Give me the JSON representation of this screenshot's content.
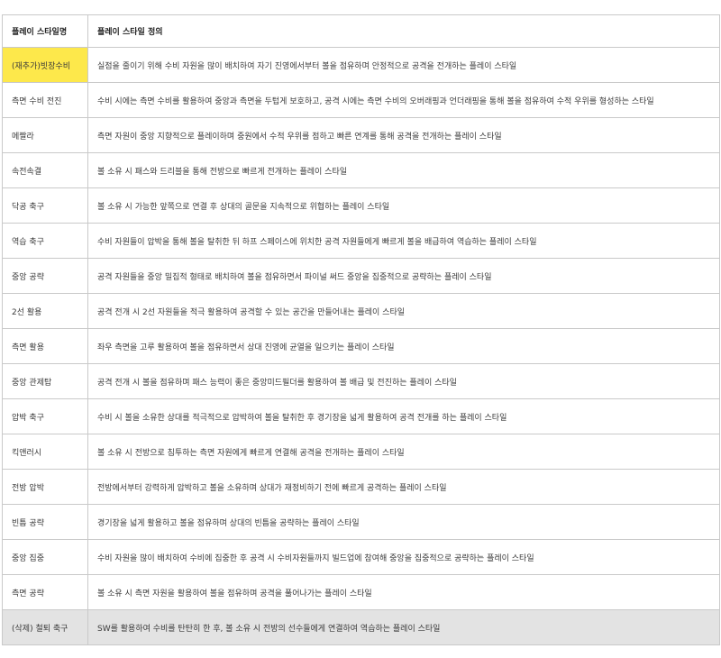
{
  "header": {
    "col_name": "플레이 스타일명",
    "col_def": "플레이 스타일 정의"
  },
  "colors": {
    "highlight_yellow": "#fde84b",
    "deleted_row_gray": "#e3e3e3",
    "border": "#c9c9c9"
  },
  "rows": [
    {
      "name": "(재추가)빗장수비",
      "def": "실점을 줄이기 위해 수비 자원을 많이 배치하여 자기 진영에서부터 볼을 점유하며 안정적으로 공격을 전개하는 플레이 스타일"
    },
    {
      "name": "측면 수비 전진",
      "def": "수비 시에는 측면 수비를 활용하여 중앙과 측면을 두텁게 보호하고, 공격 시에는 측면 수비의 오버래핑과 언더래핑을 통해 볼을 점유하여 수적 우위를 형성하는 스타일"
    },
    {
      "name": "메짤라",
      "def": "측면 자원이 중앙 지향적으로 플레이하며 중원에서 수적 우위를 점하고 빠른 연계를 통해 공격을 전개하는 플레이 스타일"
    },
    {
      "name": "속전속결",
      "def": "볼 소유 시 패스와 드리블을 통해 전방으로 빠르게 전개하는 플레이 스타일"
    },
    {
      "name": "닥공 축구",
      "def": "볼 소유 시 가능한 앞쪽으로 연결 후 상대의 골문을 지속적으로 위협하는 플레이 스타일"
    },
    {
      "name": "역습 축구",
      "def": "수비 자원들이 압박을 통해 볼을 탈취한 뒤 하프 스페이스에 위치한 공격 자원들에게 빠르게 볼을 배급하여 역습하는 플레이 스타일"
    },
    {
      "name": "중앙 공략",
      "def": "공격 자원들을 중앙 밀집적 형태로 배치하여 볼을 점유하면서 파이널 써드 중앙을 집중적으로 공략하는 플레이 스타일"
    },
    {
      "name": "2선 활용",
      "def": "공격 전개 시 2선 자원들을 적극 활용하여 공격할 수 있는 공간을 만들어내는 플레이 스타일"
    },
    {
      "name": "측면 활용",
      "def": "좌우 측면을 고루 활용하여 볼을 점유하면서 상대 진영에 균열을 일으키는 플레이 스타일"
    },
    {
      "name": "중앙 관제탑",
      "def": "공격 전개 시 볼을 점유하며 패스 능력이 좋은 중앙미드필더를 활용하여 볼 배급 및 전진하는 플레이 스타일"
    },
    {
      "name": "압박 축구",
      "def": "수비 시 볼을 소유한 상대를 적극적으로 압박하여 볼을 탈취한 후 경기장을 넓게 활용하여 공격 전개를 하는 플레이 스타일"
    },
    {
      "name": "킥앤러시",
      "def": "볼 소유 시 전방으로 침투하는 측면 자원에게 빠르게 연결해 공격을 전개하는 플레이 스타일"
    },
    {
      "name": "전방 압박",
      "def": "전방에서부터 강력하게 압박하고 볼을 소유하며 상대가 재정비하기 전에 빠르게 공격하는 플레이 스타일"
    },
    {
      "name": "빈틈 공략",
      "def": "경기장을 넓게 활용하고 볼을 점유하며 상대의 빈틈을 공략하는 플레이 스타일"
    },
    {
      "name": "중앙 집중",
      "def": "수비 자원을 많이 배치하여 수비에 집중한 후 공격 시 수비자원들까지 빌드업에 참여해 중앙을 집중적으로 공략하는 플레이 스타일"
    },
    {
      "name": "측면 공략",
      "def": "볼 소유 시 측면 자원을 활용하여 볼을 점유하며 공격을 풀어나가는 플레이 스타일"
    },
    {
      "name": "(삭제) 철퇴 축구",
      "def": "SW를 활용하여 수비를 탄탄히 한 후, 볼 소유 시 전방의 선수들에게 연결하여 역습하는 플레이 스타일"
    }
  ]
}
